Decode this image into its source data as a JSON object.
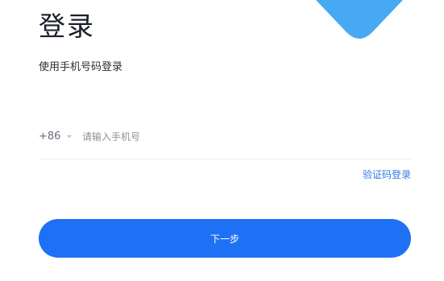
{
  "login": {
    "title": "登录",
    "subtitle": "使用手机号码登录",
    "country_code": "+86",
    "phone_placeholder": "请输入手机号",
    "phone_value": "",
    "alt_login_link": "验证码登录",
    "next_button": "下一步"
  },
  "colors": {
    "primary": "#1e71f5",
    "link": "#2f7ae5",
    "decoration": "#47a9f3"
  },
  "icons": {
    "country_dropdown": "caret-down-icon",
    "decoration": "blue-shape-graphic"
  }
}
